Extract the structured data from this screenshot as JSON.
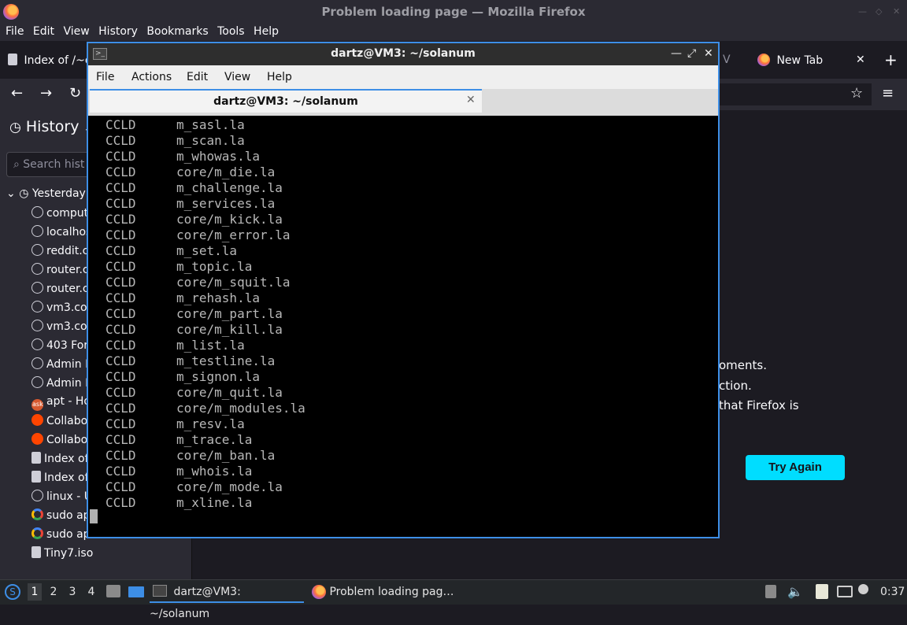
{
  "firefox": {
    "window_title": "Problem loading page — Mozilla Firefox",
    "menu": [
      "File",
      "Edit",
      "View",
      "History",
      "Bookmarks",
      "Tools",
      "Help"
    ],
    "tabs": [
      {
        "label": "Index of /~d"
      },
      {
        "label": "V"
      },
      {
        "label": "New Tab"
      }
    ],
    "sidebar": {
      "heading": "History",
      "search_placeholder": "Search hist",
      "group": "Yesterday",
      "items": [
        {
          "label": "comput",
          "icon": "globe-icon"
        },
        {
          "label": "localhos",
          "icon": "globe-icon"
        },
        {
          "label": "reddit.c",
          "icon": "globe-icon"
        },
        {
          "label": "router.c",
          "icon": "globe-icon"
        },
        {
          "label": "router.c",
          "icon": "globe-icon"
        },
        {
          "label": "vm3.co",
          "icon": "globe-icon"
        },
        {
          "label": "vm3.co",
          "icon": "globe-icon"
        },
        {
          "label": "403 For",
          "icon": "globe-icon"
        },
        {
          "label": "Admin P",
          "icon": "globe-icon"
        },
        {
          "label": "Admin P",
          "icon": "globe-icon"
        },
        {
          "label": "apt - Ho",
          "icon": "askubuntu-icon"
        },
        {
          "label": "Collabo",
          "icon": "reddit-icon"
        },
        {
          "label": "Collabo",
          "icon": "reddit-icon"
        },
        {
          "label": "Index of",
          "icon": "page-icon"
        },
        {
          "label": "Index of",
          "icon": "page-icon"
        },
        {
          "label": "linux - U",
          "icon": "globe-icon"
        },
        {
          "label": "sudo ap",
          "icon": "google-icon"
        },
        {
          "label": "sudo ap",
          "icon": "google-icon"
        },
        {
          "label": "Tiny7.iso",
          "icon": "page-icon"
        }
      ]
    },
    "error_lines": [
      "oments.",
      "ction.",
      "that Firefox is"
    ],
    "try_again": "Try Again"
  },
  "terminal": {
    "title": "dartz@VM3: ~/solanum",
    "menu": [
      "File",
      "Actions",
      "Edit",
      "View",
      "Help"
    ],
    "tab_label": "dartz@VM3: ~/solanum",
    "lines": [
      [
        "CCLD",
        "m_sasl.la"
      ],
      [
        "CCLD",
        "m_scan.la"
      ],
      [
        "CCLD",
        "m_whowas.la"
      ],
      [
        "CCLD",
        "core/m_die.la"
      ],
      [
        "CCLD",
        "m_challenge.la"
      ],
      [
        "CCLD",
        "m_services.la"
      ],
      [
        "CCLD",
        "core/m_kick.la"
      ],
      [
        "CCLD",
        "core/m_error.la"
      ],
      [
        "CCLD",
        "m_set.la"
      ],
      [
        "CCLD",
        "m_topic.la"
      ],
      [
        "CCLD",
        "core/m_squit.la"
      ],
      [
        "CCLD",
        "m_rehash.la"
      ],
      [
        "CCLD",
        "core/m_part.la"
      ],
      [
        "CCLD",
        "core/m_kill.la"
      ],
      [
        "CCLD",
        "m_list.la"
      ],
      [
        "CCLD",
        "m_testline.la"
      ],
      [
        "CCLD",
        "m_signon.la"
      ],
      [
        "CCLD",
        "core/m_quit.la"
      ],
      [
        "CCLD",
        "core/m_modules.la"
      ],
      [
        "CCLD",
        "m_resv.la"
      ],
      [
        "CCLD",
        "m_trace.la"
      ],
      [
        "CCLD",
        "core/m_ban.la"
      ],
      [
        "CCLD",
        "m_whois.la"
      ],
      [
        "CCLD",
        "core/m_mode.la"
      ],
      [
        "CCLD",
        "m_xline.la"
      ]
    ]
  },
  "taskbar": {
    "desktops": [
      "1",
      "2",
      "3",
      "4"
    ],
    "tasks": [
      {
        "label": "dartz@VM3: ~/solanum"
      },
      {
        "label": "Problem loading pag…"
      }
    ],
    "clock": "0:37"
  }
}
